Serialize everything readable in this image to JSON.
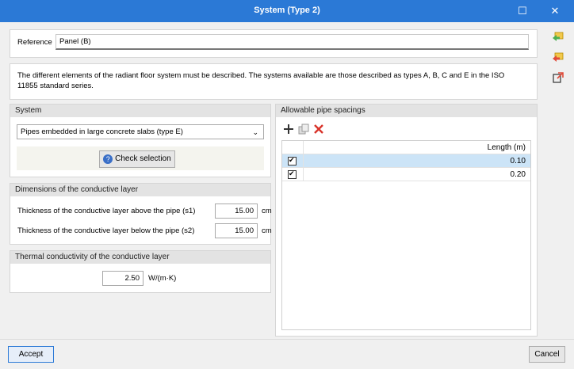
{
  "window": {
    "title": "System (Type 2)",
    "maximize_glyph": "☐",
    "close_glyph": "✕"
  },
  "reference": {
    "label": "Reference",
    "value": "Panel (B)"
  },
  "description": "The different elements of the radiant floor system must be described. The systems available are those described as types A, B, C and E in the ISO 11855 standard series.",
  "system": {
    "header": "System",
    "selected": "Pipes embedded in large concrete slabs (type E)",
    "check_button": "Check selection"
  },
  "dimensions": {
    "header": "Dimensions of the conductive layer",
    "above": {
      "label": "Thickness of the conductive layer above the pipe (s1)",
      "value": "15.00",
      "unit": "cm"
    },
    "below": {
      "label": "Thickness of the conductive layer below the pipe (s2)",
      "value": "15.00",
      "unit": "cm"
    }
  },
  "conductivity": {
    "header": "Thermal conductivity of the conductive layer",
    "value": "2.50",
    "unit": "W/(m·K)"
  },
  "spacings": {
    "header": "Allowable pipe spacings",
    "column": "Length (m)",
    "rows": [
      {
        "value": "0.10",
        "checked": true,
        "selected": true
      },
      {
        "value": "0.20",
        "checked": true,
        "selected": false
      }
    ]
  },
  "footer": {
    "accept": "Accept",
    "cancel": "Cancel"
  },
  "colors": {
    "titlebar": "#2b79d6",
    "row_selected": "#cce4f7",
    "delete": "#d9342b"
  }
}
